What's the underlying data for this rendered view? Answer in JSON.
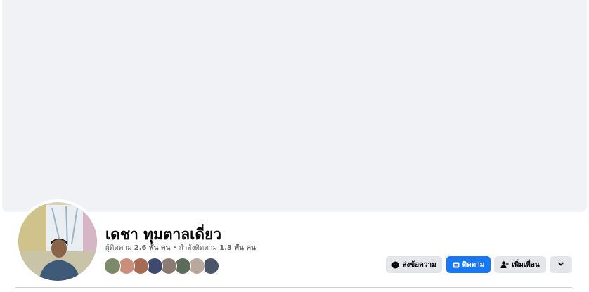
{
  "profile": {
    "name": "เดชา ทุมตาลเดี่ยว",
    "followers_label": "ผู้ติดตาม",
    "followers_count": "2.6 พัน คน",
    "separator": "•",
    "following_label": "กำลังติดตาม",
    "following_count": "1.3 พัน คน"
  },
  "mutual_friends": [
    {
      "color": "#7d8a6a"
    },
    {
      "color": "#c98f7a"
    },
    {
      "color": "#a66b55"
    },
    {
      "color": "#3e4a6b"
    },
    {
      "color": "#8c7b72"
    },
    {
      "color": "#5d6b5a"
    },
    {
      "color": "#b9a89c"
    },
    {
      "color": "#4b5568"
    }
  ],
  "actions": {
    "message_label": "ส่งข้อความ",
    "follow_label": "ติดตาม",
    "add_friend_label": "เพิ่มเพื่อน"
  },
  "colors": {
    "primary": "#1877f2",
    "secondary_button": "#e4e6eb",
    "cover_background": "#f0f2f5"
  }
}
